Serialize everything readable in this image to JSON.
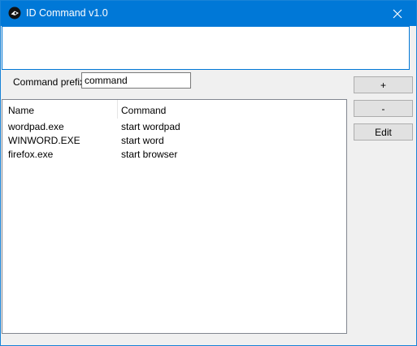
{
  "window": {
    "title": "ID Command v1.0",
    "icon": "app-icon",
    "accent_color": "#0078d7"
  },
  "log": {
    "value": ""
  },
  "prefix": {
    "label": "Command prefix:",
    "value": "command"
  },
  "table": {
    "columns": [
      "Name",
      "Command"
    ],
    "rows": [
      {
        "name": "wordpad.exe",
        "command": "start wordpad"
      },
      {
        "name": "WINWORD.EXE",
        "command": "start word"
      },
      {
        "name": "firefox.exe",
        "command": "start browser"
      }
    ]
  },
  "buttons": {
    "add": "+",
    "remove": "-",
    "edit": "Edit"
  }
}
